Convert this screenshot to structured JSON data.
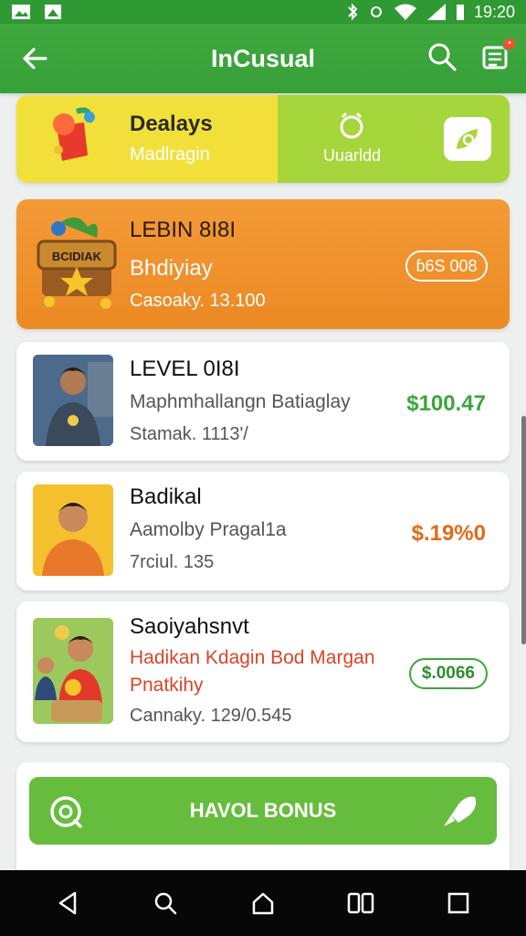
{
  "status_bar": {
    "time": "19:20",
    "left_icons": [
      "gallery-icon",
      "image-icon"
    ],
    "right_icons": [
      "bluetooth-icon",
      "vibrate-icon",
      "wifi-icon",
      "signal-icon",
      "battery-icon"
    ]
  },
  "app_bar": {
    "title": "InCusual",
    "back_icon": "arrow-left-icon",
    "actions": [
      "search-icon",
      "notification-list-icon"
    ]
  },
  "deals_card": {
    "title": "Dealays",
    "subtitle": "Madlragin",
    "right_label": "Uuarldd"
  },
  "promo_card": {
    "title": "LEBIN 8I8I",
    "subtitle": "Bhdiyiay",
    "meta": "Casoaky. 13.100",
    "pill": "ɓ6S 008"
  },
  "items": [
    {
      "title": "LEVEL   0I8I",
      "line": "Maphmhallangn Batiaglay",
      "meta": "Stamak.   1113'/",
      "price": "$100.47",
      "price_color": "#3aa63a"
    },
    {
      "title": "Badikal",
      "line": "Aamolby  Pragal1a",
      "meta": "7rciul.    135",
      "price": "$.19%0",
      "price_color": "#e06a1a"
    },
    {
      "title": "Saoiyahsnvt",
      "line": "Hadikan Kdagin Bod Margan",
      "line2": "Pnatkihy",
      "meta": "Cannaky. 129/0.545",
      "price": "$.0066",
      "line_color": "#d94428"
    }
  ],
  "bonus_button": {
    "label": "HAVOL BONUS"
  },
  "nav_bar": {
    "buttons": [
      "back-triangle-icon",
      "search-icon",
      "home-icon",
      "recents-icon",
      "square-icon"
    ]
  },
  "colors": {
    "app_bar": "#3fa83f",
    "deals_left": "#f2e03a",
    "deals_right": "#a6d63c",
    "promo": "#ec8a24",
    "bonus": "#66bd3d",
    "price_green": "#3aa63a",
    "price_orange": "#e06a1a",
    "accent_red": "#d94428"
  }
}
